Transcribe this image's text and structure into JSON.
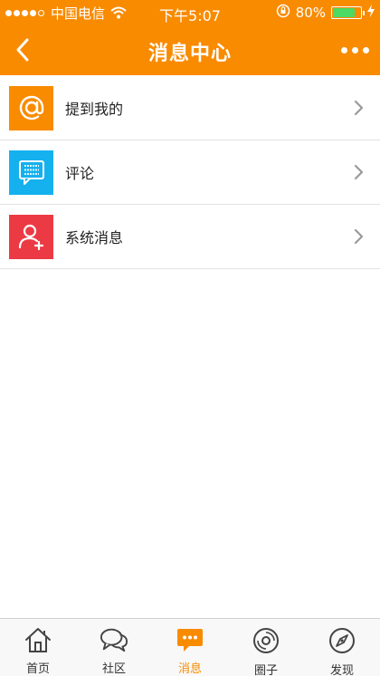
{
  "status_bar": {
    "carrier": "中国电信",
    "time": "下午5:07",
    "battery_percent": "80%",
    "battery_level": 0.8
  },
  "nav": {
    "title": "消息中心",
    "back_icon": "chevron-left-icon",
    "more_icon": "more-dots-icon"
  },
  "items": [
    {
      "label": "提到我的",
      "icon": "at-icon",
      "color": "#f98b00"
    },
    {
      "label": "评论",
      "icon": "comment-icon",
      "color": "#15b1ee"
    },
    {
      "label": "系统消息",
      "icon": "user-add-icon",
      "color": "#ec3a44"
    }
  ],
  "tabs": [
    {
      "label": "首页",
      "icon": "home-icon",
      "active": false
    },
    {
      "label": "社区",
      "icon": "chat-bubbles-icon",
      "active": false
    },
    {
      "label": "消息",
      "icon": "message-icon",
      "active": true
    },
    {
      "label": "圈子",
      "icon": "disc-icon",
      "active": false
    },
    {
      "label": "发现",
      "icon": "compass-icon",
      "active": false
    }
  ],
  "colors": {
    "accent": "#f98b00",
    "tab_active": "#f98b00",
    "divider": "#e2e2e2"
  }
}
